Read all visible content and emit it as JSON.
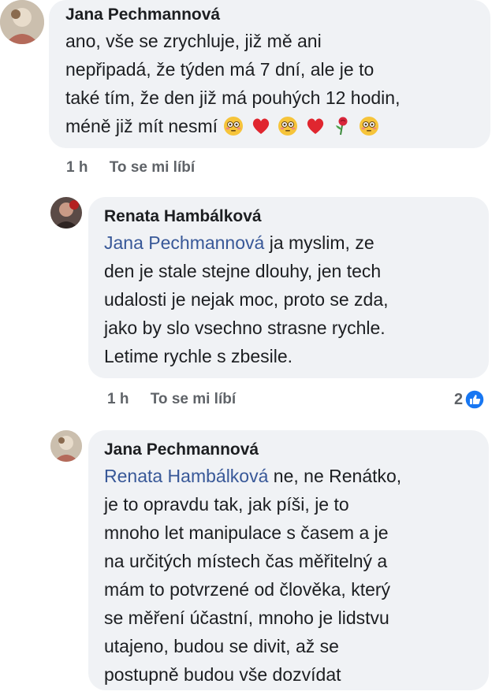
{
  "comments": [
    {
      "author": "Jana Pechmannová",
      "text_lines": [
        "ano, vše se zrychluje, již mě ani",
        "nepřipadá, že týden má 7 dní, ale je to",
        "také tím, že den již má pouhých 12 hodin,",
        "méně již mít nesmí"
      ],
      "emoji": [
        "flushed-face-icon",
        "red-heart-icon",
        "flushed-face-icon",
        "red-heart-icon",
        "rose-icon",
        "flushed-face-icon"
      ],
      "time": "1 h",
      "like_label": "To se mi líbí"
    },
    {
      "author": "Renata Hambálková",
      "mention": "Jana Pechmannová",
      "text_first_line_rest": " ja myslim, ze",
      "text_lines": [
        "den je stale stejne dlouhy, jen tech",
        "udalosti je nejak moc, proto se zda,",
        "jako by slo vsechno strasne rychle.",
        "Letime rychle s zbesile."
      ],
      "time": "1 h",
      "like_label": "To se mi líbí",
      "reaction_count": "2"
    },
    {
      "author": "Jana Pechmannová",
      "mention": "Renata Hambálková",
      "text_first_line_rest": " ne, ne Renátko,",
      "text_lines": [
        "je to opravdu tak, jak píši, je to",
        "mnoho let manipulace s časem a je",
        "na určitých místech čas měřitelný a",
        "mám to potvrzené od člověka, který",
        "se měření účastní, mnoho je lidstvu",
        "utajeno, budou se divit, až se",
        "postupně budou vše dozvídat"
      ]
    }
  ],
  "colors": {
    "bubble": "#f0f2f5",
    "mention": "#385898",
    "like_blue": "#1877f2"
  }
}
